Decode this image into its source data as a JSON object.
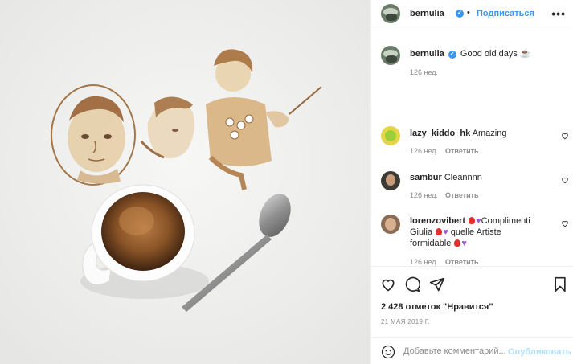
{
  "post": {
    "username": "bernulia",
    "separator": "•",
    "follow_label": "Подписаться",
    "more_label": "•••",
    "verified_mark": "✓",
    "caption": {
      "username": "bernulia",
      "text": "Good old days ☕",
      "time": "126 нед."
    }
  },
  "comments": [
    {
      "username": "lazy_kiddo_hk",
      "text": "Amazing",
      "time": "126 нед.",
      "reply_label": "Ответить"
    },
    {
      "username": "sambur",
      "text": "Cleannnn",
      "time": "126 нед.",
      "reply_label": "Ответить"
    },
    {
      "username": "lorenzovibert",
      "text_1": "Complimenti",
      "text_2": "Giulia",
      "text_3": "quelle Artiste",
      "text_4": "formidable",
      "time": "126 нед.",
      "reply_label": "Ответить"
    }
  ],
  "actions": {
    "icons": [
      "heart-icon",
      "comment-icon",
      "share-icon",
      "bookmark-icon"
    ],
    "likes": "2 428 отметок \"Нравится\"",
    "date": "21 МАЯ 2019 Г."
  },
  "add_comment": {
    "placeholder": "Добавьте комментарий...",
    "publish_label": "Опубликовать"
  },
  "colors": {
    "accent": "#3897f0",
    "muted": "#8e8e8e",
    "publish_disabled": "#b2dffc"
  }
}
